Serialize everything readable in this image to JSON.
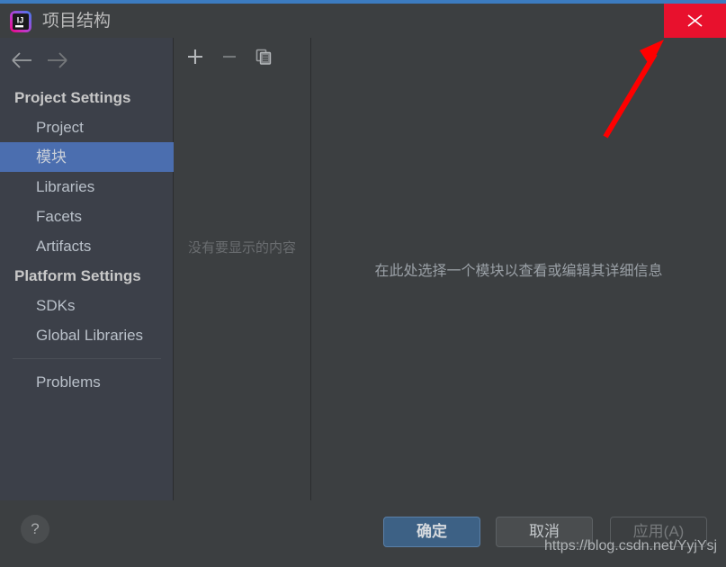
{
  "window": {
    "title": "项目结构",
    "logo_icon": "intellij-idea-logo",
    "close_label": "✕",
    "accent_color": "#3c7bc0",
    "close_color": "#e8112d"
  },
  "sidebar": {
    "nav": {
      "back_icon": "arrow-left-icon",
      "forward_icon": "arrow-right-icon"
    },
    "sections": [
      {
        "type": "group",
        "label": "Project Settings"
      },
      {
        "type": "item",
        "label": "Project",
        "selected": false
      },
      {
        "type": "item",
        "label": "模块",
        "selected": true
      },
      {
        "type": "item",
        "label": "Libraries",
        "selected": false
      },
      {
        "type": "item",
        "label": "Facets",
        "selected": false
      },
      {
        "type": "item",
        "label": "Artifacts",
        "selected": false
      },
      {
        "type": "group",
        "label": "Platform Settings"
      },
      {
        "type": "item",
        "label": "SDKs",
        "selected": false
      },
      {
        "type": "item",
        "label": "Global Libraries",
        "selected": false
      },
      {
        "type": "divider"
      },
      {
        "type": "item",
        "label": "Problems",
        "selected": false
      }
    ],
    "selection_color": "#4b6eaf"
  },
  "middle_panel": {
    "toolbar": {
      "add_icon": "plus-icon",
      "remove_icon": "minus-icon",
      "copy_icon": "copy-icon"
    },
    "empty_text": "没有要显示的内容"
  },
  "detail_panel": {
    "message": "在此处选择一个模块以查看或编辑其详细信息"
  },
  "footer": {
    "help_label": "?",
    "ok_label": "确定",
    "cancel_label": "取消",
    "apply_label": "应用(A)"
  },
  "annotation": {
    "arrow_icon": "red-arrow-pointing-to-close-button",
    "arrow_color": "#ff0000",
    "watermark": "https://blog.csdn.net/YyjYsj"
  }
}
